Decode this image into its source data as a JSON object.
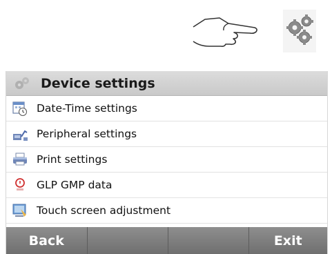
{
  "header": {
    "title": "Device settings",
    "title_icon": "gears-icon"
  },
  "illustration": {
    "pointer_icon": "pointing-hand-icon",
    "settings_icon": "gears-icon"
  },
  "menu": {
    "items": [
      {
        "label": "Date-Time settings",
        "icon": "calendar-clock-icon"
      },
      {
        "label": "Peripheral settings",
        "icon": "peripheral-icon"
      },
      {
        "label": "Print settings",
        "icon": "printer-icon"
      },
      {
        "label": "GLP GMP data",
        "icon": "glp-data-icon"
      },
      {
        "label": "Touch screen adjustment",
        "icon": "touch-screen-icon"
      }
    ]
  },
  "footer": {
    "back_label": "Back",
    "mid1_label": "",
    "mid2_label": "",
    "exit_label": "Exit"
  },
  "colors": {
    "title_bar": "#d3d3d3",
    "softkey": "#7e7e7e",
    "softkey_text": "#ffffff"
  }
}
